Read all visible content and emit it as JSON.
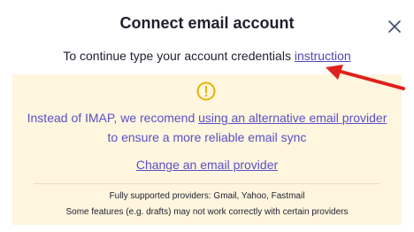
{
  "dialog": {
    "title": "Connect email account",
    "subtitle_prefix": "To continue type your account credentials ",
    "instruction_link": "instruction",
    "close_icon": "close-icon"
  },
  "warning": {
    "icon": "warning-circle-icon",
    "line1_prefix": "Instead of IMAP, we recomend ",
    "line1_link": "using an alternative email provider",
    "line2": "to ensure a more reliable email sync",
    "change_link": "Change an email provider",
    "note1": "Fully supported providers: Gmail, Yahoo, Fastmail",
    "note2": "Some features (e.g. drafts) may not work correctly with certain providers"
  },
  "colors": {
    "link": "#5b4fc8",
    "warning_bg": "#fef6de",
    "warning_icon": "#e8b400",
    "arrow": "#e0201c"
  }
}
